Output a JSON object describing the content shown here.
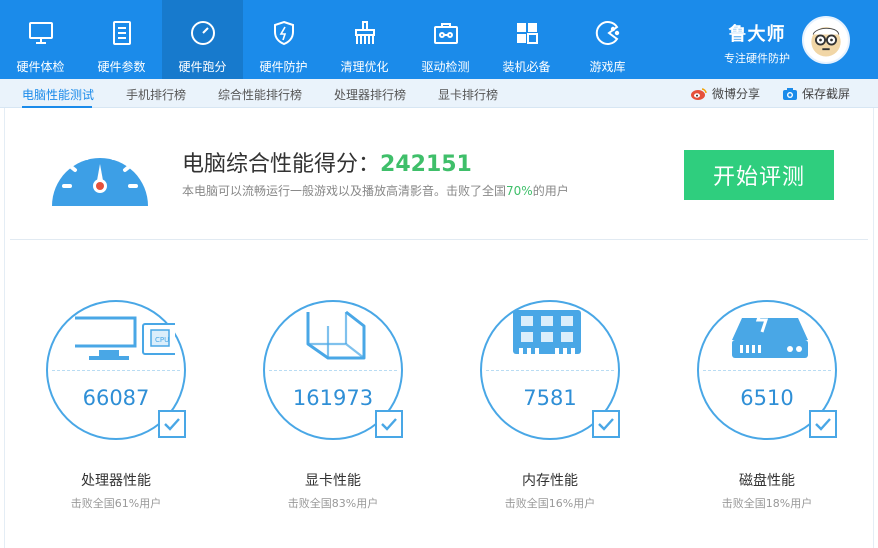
{
  "colors": {
    "accent": "#1b8bea",
    "score_green": "#3fbf6a",
    "button_green": "#2fce7e",
    "ring_blue": "#49a7e6"
  },
  "nav": {
    "items": [
      {
        "label": "硬件体检",
        "icon": "monitor-icon"
      },
      {
        "label": "硬件参数",
        "icon": "document-icon"
      },
      {
        "label": "硬件跑分",
        "icon": "speedometer-icon",
        "active": true
      },
      {
        "label": "硬件防护",
        "icon": "shield-icon"
      },
      {
        "label": "清理优化",
        "icon": "broom-icon"
      },
      {
        "label": "驱动检测",
        "icon": "toolbox-icon"
      },
      {
        "label": "装机必备",
        "icon": "grid-icon"
      },
      {
        "label": "游戏库",
        "icon": "gamepad-icon"
      }
    ]
  },
  "brand": {
    "name": "鲁大师",
    "subtitle": "专注硬件防护"
  },
  "subtabs": [
    {
      "label": "电脑性能测试",
      "active": true
    },
    {
      "label": "手机排行榜"
    },
    {
      "label": "综合性能排行榜"
    },
    {
      "label": "处理器排行榜"
    },
    {
      "label": "显卡排行榜"
    }
  ],
  "share": {
    "weibo": "微博分享",
    "screenshot": "保存截屏"
  },
  "score": {
    "title_prefix": "电脑综合性能得分：",
    "value": "242151",
    "desc_prefix": "本电脑可以流畅运行一般游戏以及播放高清影音。击败了全国",
    "desc_pct": "70%",
    "desc_suffix": "的用户"
  },
  "start_button": "开始评测",
  "metrics": [
    {
      "name": "处理器性能",
      "value": "66087",
      "sub": "击败全国61%用户",
      "icon": "cpu-monitor-icon"
    },
    {
      "name": "显卡性能",
      "value": "161973",
      "sub": "击败全国83%用户",
      "icon": "graphics-card-icon"
    },
    {
      "name": "内存性能",
      "value": "7581",
      "sub": "击败全国16%用户",
      "icon": "memory-chip-icon"
    },
    {
      "name": "磁盘性能",
      "value": "6510",
      "sub": "击败全国18%用户",
      "icon": "hard-disk-icon"
    }
  ]
}
